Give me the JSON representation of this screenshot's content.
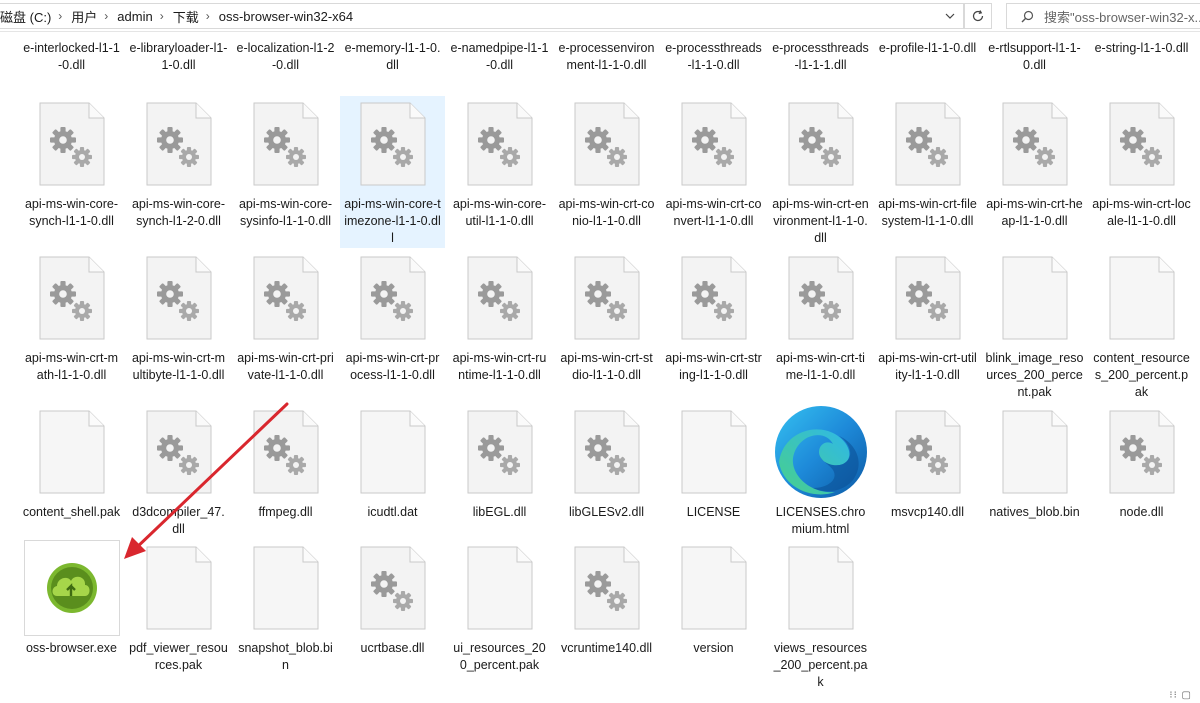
{
  "address": {
    "crumbs": [
      "磁盘 (C:)",
      "用户",
      "admin",
      "下载",
      "oss-browser-win32-x64"
    ],
    "search_placeholder": "搜索\"oss-browser-win32-x..."
  },
  "files_top_partial": [
    "e-interlocked-l1-1-0.dll",
    "e-libraryloader-l1-1-0.dll",
    "e-localization-l1-2-0.dll",
    "e-memory-l1-1-0.dll",
    "e-namedpipe-l1-1-0.dll",
    "e-processenvironment-l1-1-0.dll",
    "e-processthreads-l1-1-0.dll",
    "e-processthreads-l1-1-1.dll",
    "e-profile-l1-1-0.dll",
    "e-rtlsupport-l1-1-0.dll",
    "e-string-l1-1-0.dll"
  ],
  "files": [
    {
      "name": "api-ms-win-core-synch-l1-1-0.dll",
      "icon": "dll-gear-icon"
    },
    {
      "name": "api-ms-win-core-synch-l1-2-0.dll",
      "icon": "dll-gear-icon"
    },
    {
      "name": "api-ms-win-core-sysinfo-l1-1-0.dll",
      "icon": "dll-gear-icon"
    },
    {
      "name": "api-ms-win-core-timezone-l1-1-0.dll",
      "icon": "dll-gear-icon",
      "selected": true
    },
    {
      "name": "api-ms-win-core-util-l1-1-0.dll",
      "icon": "dll-gear-icon"
    },
    {
      "name": "api-ms-win-crt-conio-l1-1-0.dll",
      "icon": "dll-gear-icon"
    },
    {
      "name": "api-ms-win-crt-convert-l1-1-0.dll",
      "icon": "dll-gear-icon"
    },
    {
      "name": "api-ms-win-crt-environment-l1-1-0.dll",
      "icon": "dll-gear-icon"
    },
    {
      "name": "api-ms-win-crt-filesystem-l1-1-0.dll",
      "icon": "dll-gear-icon"
    },
    {
      "name": "api-ms-win-crt-heap-l1-1-0.dll",
      "icon": "dll-gear-icon"
    },
    {
      "name": "api-ms-win-crt-locale-l1-1-0.dll",
      "icon": "dll-gear-icon"
    },
    {
      "name": "api-ms-win-crt-math-l1-1-0.dll",
      "icon": "dll-gear-icon"
    },
    {
      "name": "api-ms-win-crt-multibyte-l1-1-0.dll",
      "icon": "dll-gear-icon"
    },
    {
      "name": "api-ms-win-crt-private-l1-1-0.dll",
      "icon": "dll-gear-icon"
    },
    {
      "name": "api-ms-win-crt-process-l1-1-0.dll",
      "icon": "dll-gear-icon"
    },
    {
      "name": "api-ms-win-crt-runtime-l1-1-0.dll",
      "icon": "dll-gear-icon"
    },
    {
      "name": "api-ms-win-crt-stdio-l1-1-0.dll",
      "icon": "dll-gear-icon"
    },
    {
      "name": "api-ms-win-crt-string-l1-1-0.dll",
      "icon": "dll-gear-icon"
    },
    {
      "name": "api-ms-win-crt-time-l1-1-0.dll",
      "icon": "dll-gear-icon"
    },
    {
      "name": "api-ms-win-crt-utility-l1-1-0.dll",
      "icon": "dll-gear-icon"
    },
    {
      "name": "blink_image_resources_200_percent.pak",
      "icon": "blank-file-icon"
    },
    {
      "name": "content_resources_200_percent.pak",
      "icon": "blank-file-icon"
    },
    {
      "name": "content_shell.pak",
      "icon": "blank-file-icon"
    },
    {
      "name": "d3dcompiler_47.dll",
      "icon": "dll-gear-icon"
    },
    {
      "name": "ffmpeg.dll",
      "icon": "dll-gear-icon"
    },
    {
      "name": "icudtl.dat",
      "icon": "blank-file-icon"
    },
    {
      "name": "libEGL.dll",
      "icon": "dll-gear-icon"
    },
    {
      "name": "libGLESv2.dll",
      "icon": "dll-gear-icon"
    },
    {
      "name": "LICENSE",
      "icon": "blank-file-icon"
    },
    {
      "name": "LICENSES.chromium.html",
      "icon": "edge-browser-icon"
    },
    {
      "name": "msvcp140.dll",
      "icon": "dll-gear-icon"
    },
    {
      "name": "natives_blob.bin",
      "icon": "blank-file-icon"
    },
    {
      "name": "node.dll",
      "icon": "dll-gear-icon"
    },
    {
      "name": "oss-browser.exe",
      "icon": "oss-browser-app-icon",
      "focused": true
    },
    {
      "name": "pdf_viewer_resources.pak",
      "icon": "blank-file-icon"
    },
    {
      "name": "snapshot_blob.bin",
      "icon": "blank-file-icon"
    },
    {
      "name": "ucrtbase.dll",
      "icon": "dll-gear-icon"
    },
    {
      "name": "ui_resources_200_percent.pak",
      "icon": "blank-file-icon"
    },
    {
      "name": "vcruntime140.dll",
      "icon": "dll-gear-icon"
    },
    {
      "name": "version",
      "icon": "blank-file-icon"
    },
    {
      "name": "views_resources_200_percent.pak",
      "icon": "blank-file-icon"
    }
  ],
  "colors": {
    "selection": "#e5f3ff",
    "annotation_arrow": "#d9272e",
    "oss_green": "#7cb82f"
  }
}
